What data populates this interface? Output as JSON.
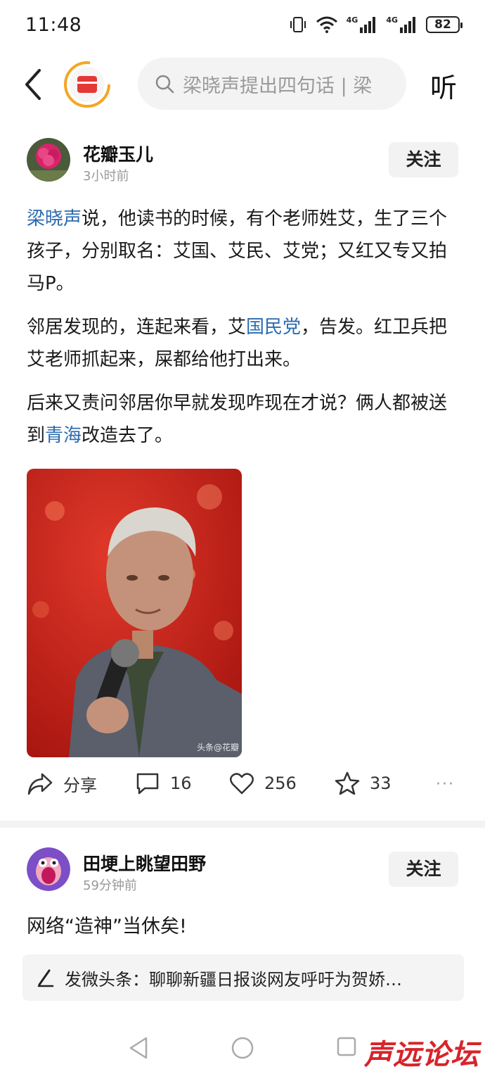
{
  "status_bar": {
    "time": "11:48",
    "network_1": "4G",
    "network_2": "4G",
    "battery": "82"
  },
  "nav": {
    "search_placeholder": "梁晓声提出四句话 | 梁",
    "listen_label": "听"
  },
  "post": {
    "author": "花瓣玉儿",
    "time": "3小时前",
    "follow_label": "关注",
    "paragraph_1": {
      "link": "梁晓声",
      "text": "说，他读书的时候，有个老师姓艾，生了三个孩子，分别取名：艾国、艾民、艾党；又红又专又拍马P。"
    },
    "paragraph_2": {
      "before": "邻居发现的，连起来看，艾",
      "link": "国民党",
      "after": "，告发。红卫兵把艾老师抓起来，屎都给他打出来。"
    },
    "paragraph_3": {
      "before": "后来又责问邻居你早就发现咋现在才说？俩人都被送到",
      "link": "青海",
      "after": "改造去了。"
    },
    "image_watermark": "头条@花瓣",
    "actions": {
      "share_label": "分享",
      "comments": "16",
      "likes": "256",
      "favorites": "33"
    }
  },
  "post2": {
    "author": "田埂上眺望田野",
    "time": "59分钟前",
    "follow_label": "关注",
    "text": "网络“造神”当休矣!",
    "quote": "发微头条：聊聊新疆日报谈网友呼吁为贺娇…"
  },
  "watermark": "声远论坛",
  "colors": {
    "link": "#2a6bb0",
    "logo_red": "#e53935",
    "logo_orange": "#f5a623"
  }
}
